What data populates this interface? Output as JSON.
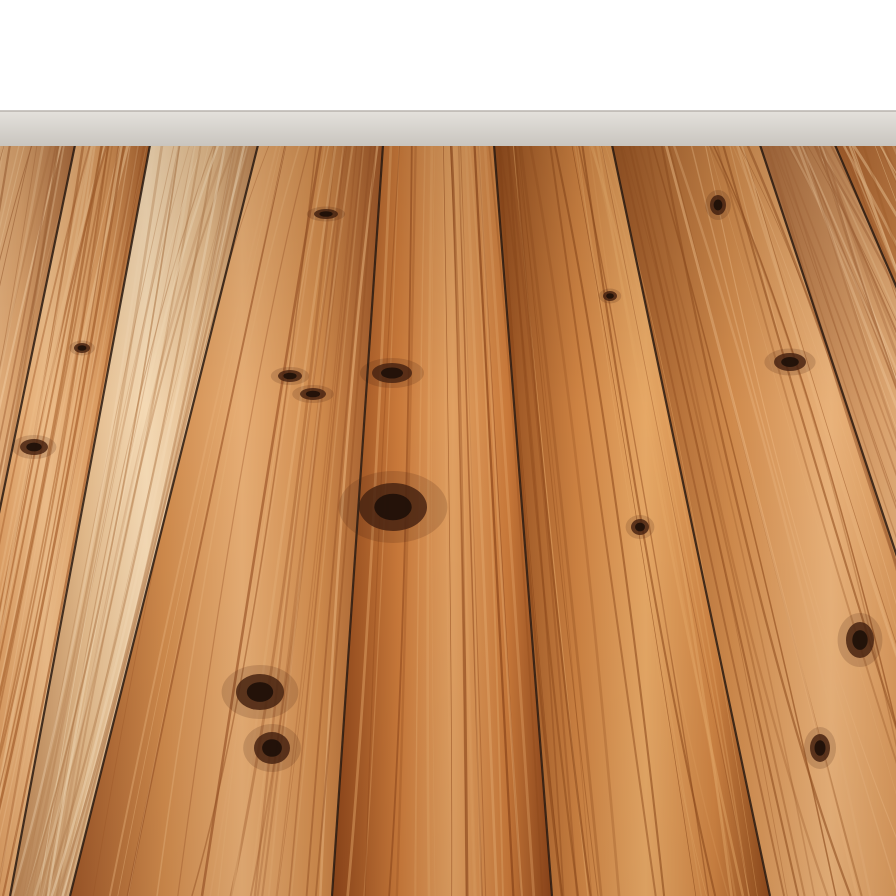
{
  "scene": {
    "subject": "wooden-floorboards",
    "colors": {
      "background": "#ffffff",
      "baseboard_top": "#e4e1dc",
      "baseboard_bottom": "#c9c5bf",
      "seam": "#2a1a10",
      "knot": "#4a2412",
      "knot_core": "#1e0f08"
    },
    "planks": [
      {
        "name": "plank-1",
        "base": "#d9a16c",
        "light": "#efc596",
        "dark": "#a96a3c"
      },
      {
        "name": "plank-2",
        "base": "#d8975c",
        "light": "#ecbc88",
        "dark": "#a8602c"
      },
      {
        "name": "plank-3",
        "base": "#e2b98a",
        "light": "#f4d9b4",
        "dark": "#b98252"
      },
      {
        "name": "plank-4",
        "base": "#cf8a4c",
        "light": "#e6ad74",
        "dark": "#9d5628"
      },
      {
        "name": "plank-5",
        "base": "#c9793a",
        "light": "#e0a062",
        "dark": "#8c4419"
      },
      {
        "name": "plank-6",
        "base": "#cd8242",
        "light": "#e6a866",
        "dark": "#8f4a1c"
      },
      {
        "name": "plank-7",
        "base": "#cf8a4c",
        "light": "#e9b27a",
        "dark": "#985424"
      }
    ]
  }
}
